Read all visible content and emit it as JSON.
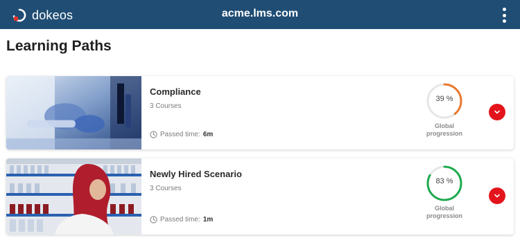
{
  "header": {
    "brand": "dokeos",
    "domain": "acme.lms.com",
    "menu_icon": "kebab-menu-icon",
    "brand_colors": {
      "bar": "#1f4d74",
      "logo_accent": "#e3342f"
    }
  },
  "page": {
    "title": "Learning Paths"
  },
  "paths": [
    {
      "title": "Compliance",
      "courses": "3 Courses",
      "passed_label": "Passed time:",
      "passed_value": "6m",
      "progress_percent": 39,
      "progress_text": "39 %",
      "progress_label_1": "Global",
      "progress_label_2": "progression",
      "ring_color": "#e8782d",
      "thumb": "lab-research-photo"
    },
    {
      "title": "Newly Hired Scenario",
      "courses": "3 Courses",
      "passed_label": "Passed time:",
      "passed_value": "1m",
      "progress_percent": 83,
      "progress_text": "83 %",
      "progress_label_1": "Global",
      "progress_label_2": "progression",
      "ring_color": "#1eaa4e",
      "thumb": "lab-worker-photo"
    }
  ]
}
